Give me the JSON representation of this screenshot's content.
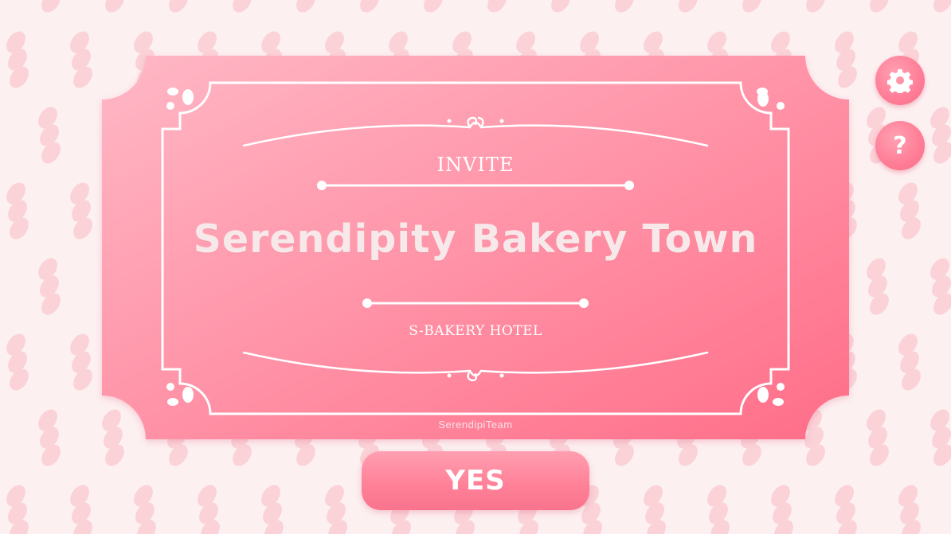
{
  "ticket": {
    "invite_label": "INVITE",
    "title": "Serendipity Bakery Town",
    "subtitle": "S-BAKERY HOTEL",
    "credit": "SerendipiTeam"
  },
  "buttons": {
    "yes_label": "YES",
    "help_label": "?",
    "settings_icon": "gear-icon",
    "help_icon": "question-icon"
  },
  "colors": {
    "background": "#fdf0f1",
    "pattern": "#f9c9d0",
    "ticket_light": "#ffb3c2",
    "ticket_dark": "#ff6f8a",
    "accent": "#ff7d96"
  }
}
